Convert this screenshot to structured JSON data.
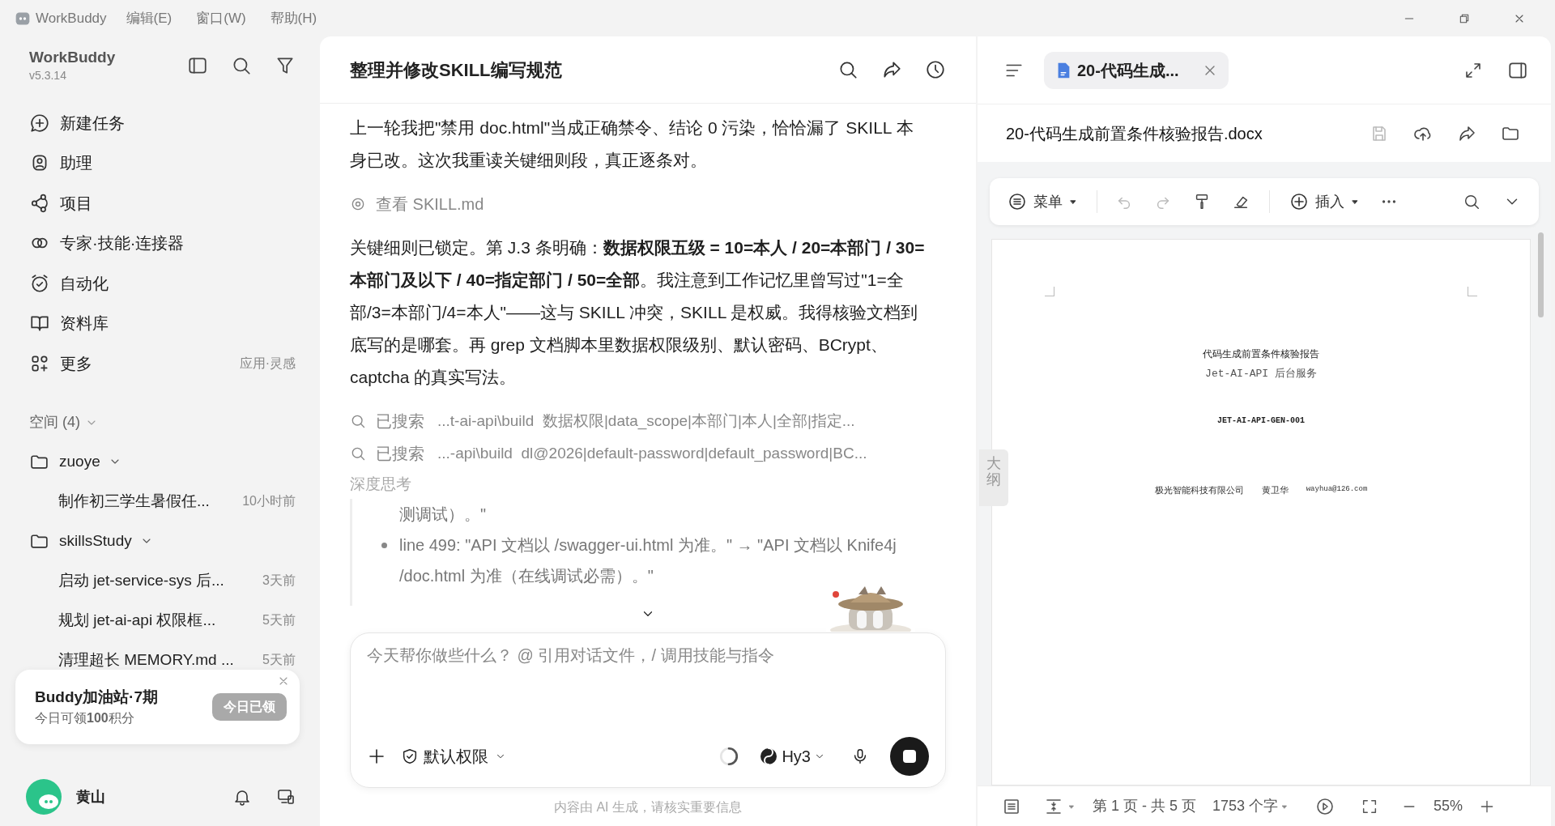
{
  "app_menu": {
    "app_name": "WorkBuddy",
    "items": [
      "编辑(E)",
      "窗口(W)",
      "帮助(H)"
    ]
  },
  "sidebar": {
    "title": "WorkBuddy",
    "version": "v5.3.14",
    "nav": [
      {
        "label": "新建任务"
      },
      {
        "label": "助理"
      },
      {
        "label": "项目"
      },
      {
        "label": "专家·技能·连接器"
      },
      {
        "label": "自动化"
      },
      {
        "label": "资料库"
      },
      {
        "label": "更多",
        "hint": "应用·灵感"
      }
    ],
    "spaces_heading": "空间 (4)",
    "spaces": [
      {
        "name": "zuoye",
        "expanded": true,
        "tasks": [
          {
            "title": "制作初三学生暑假任...",
            "time": "10小时前"
          }
        ]
      },
      {
        "name": "skillsStudy",
        "expanded": true,
        "tasks": [
          {
            "title": "启动 jet-service-sys 后...",
            "time": "3天前"
          },
          {
            "title": "规划 jet-ai-api 权限框...",
            "time": "5天前"
          },
          {
            "title": "清理超长 MEMORY.md ...",
            "time": "5天前"
          }
        ]
      }
    ],
    "promo": {
      "title": "Buddy加油站·7期",
      "text": "今日可领**100**积分",
      "button": "今日已领",
      "claimed": true
    },
    "user": {
      "name": "黄山"
    }
  },
  "chat": {
    "title": "整理并修改SKILL编写规范",
    "messages": [
      {
        "kind": "text",
        "text": "上一轮我把\"禁用 doc.html\"当成正确禁令、结论 0 污染，恰恰漏了 SKILL 本身已改。这次我重读关键细则段，真正逐条对。"
      },
      {
        "kind": "view",
        "label": "查看 SKILL.md"
      },
      {
        "kind": "text",
        "text": "关键细则已锁定。第 J.3 条明确：**数据权限五级 = 10=本人 / 20=本部门 / 30=本部门及以下 / 40=指定部门 / 50=全部**。我注意到工作记忆里曾写过\"1=全部/3=本部门/4=本人\"——这与 SKILL 冲突，SKILL 是权威。我得核验文档到底写的是哪套。再 grep 文档脚本里数据权限级别、默认密码、BCrypt、captcha 的真实写法。"
      },
      {
        "kind": "search",
        "label": "已搜索",
        "detail": "...t-ai-api\\build  数据权限|data_scope|本部门|本人|全部|指定..."
      },
      {
        "kind": "search",
        "label": "已搜索",
        "detail": "...-api\\build  dl@2026|default-password|default_password|BC..."
      }
    ],
    "thinking": {
      "label": "深度思考",
      "items": [
        {
          "kind": "line",
          "text": "测调试）。\""
        },
        {
          "kind": "bullet",
          "text": "line 499: \"API 文档以 /swagger-ui.html 为准。\" → \"API 文档以 Knife4j /doc.html 为准（在线调试必需）。\""
        }
      ]
    },
    "input": {
      "placeholder": "今天帮你做些什么？ @ 引用对话文件，/ 调用技能与指令",
      "permission": "默认权限",
      "model": "Hy3",
      "generating": true
    },
    "disclaimer": "内容由 AI 生成，请核实重要信息"
  },
  "document": {
    "tab": {
      "title": "20-代码生成...",
      "selected": true
    },
    "file_name": "20-代码生成前置条件核验报告.docx",
    "toolbar": {
      "menu": "菜单",
      "insert": "插入"
    },
    "outline": "大纲",
    "page": {
      "title": "代码生成前置条件核验报告",
      "subtitle": "Jet-AI-API 后台服务",
      "code": "JET-AI-API-GEN-001",
      "company": "极光智能科技有限公司",
      "author": "黄卫华",
      "email": "wayhua@126.com"
    },
    "status": {
      "pages": "第 1 页 - 共 5 页",
      "words": "1753 个字",
      "zoom": "55%"
    }
  }
}
